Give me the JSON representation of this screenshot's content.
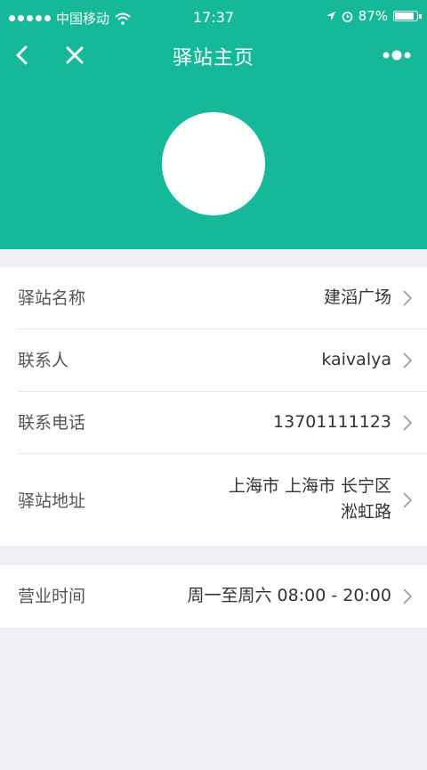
{
  "status_bar": {
    "carrier": "中国移动",
    "time": "17:37",
    "battery_text": "87%",
    "battery_level": 0.87
  },
  "nav": {
    "title": "驿站主页",
    "back_icon": "back-chevron-icon",
    "close_icon": "close-icon",
    "more_icon": "more-dots-icon"
  },
  "colors": {
    "header_bg": "#16b89a",
    "page_bg": "#efeff4"
  },
  "info_rows": [
    {
      "label": "驿站名称",
      "value": "建滔广场"
    },
    {
      "label": "联系人",
      "value": "kaivalya"
    },
    {
      "label": "联系电话",
      "value": "13701111123"
    },
    {
      "label": "驿站地址",
      "value_line1": "上海市 上海市 长宁区",
      "value_line2": "淞虹路"
    }
  ],
  "hours_row": {
    "label": "营业时间",
    "value": "周一至周六 08:00 - 20:00"
  }
}
